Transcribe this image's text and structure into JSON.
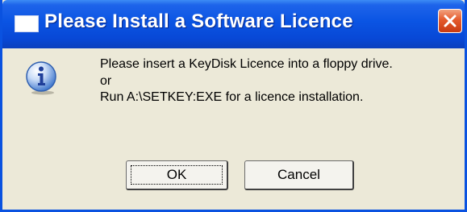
{
  "dialog": {
    "title": "Please Install a Software Licence",
    "message_lines": [
      "Please insert a KeyDisk Licence into a floppy drive.",
      "or",
      "Run A:\\SETKEY:EXE for a licence installation."
    ],
    "buttons": {
      "ok_label": "OK",
      "cancel_label": "Cancel"
    },
    "icon": "information-icon"
  },
  "colors": {
    "titlebar": "#0a54e3",
    "close_button": "#e45a2c",
    "dialog_background": "#ece9d8"
  }
}
